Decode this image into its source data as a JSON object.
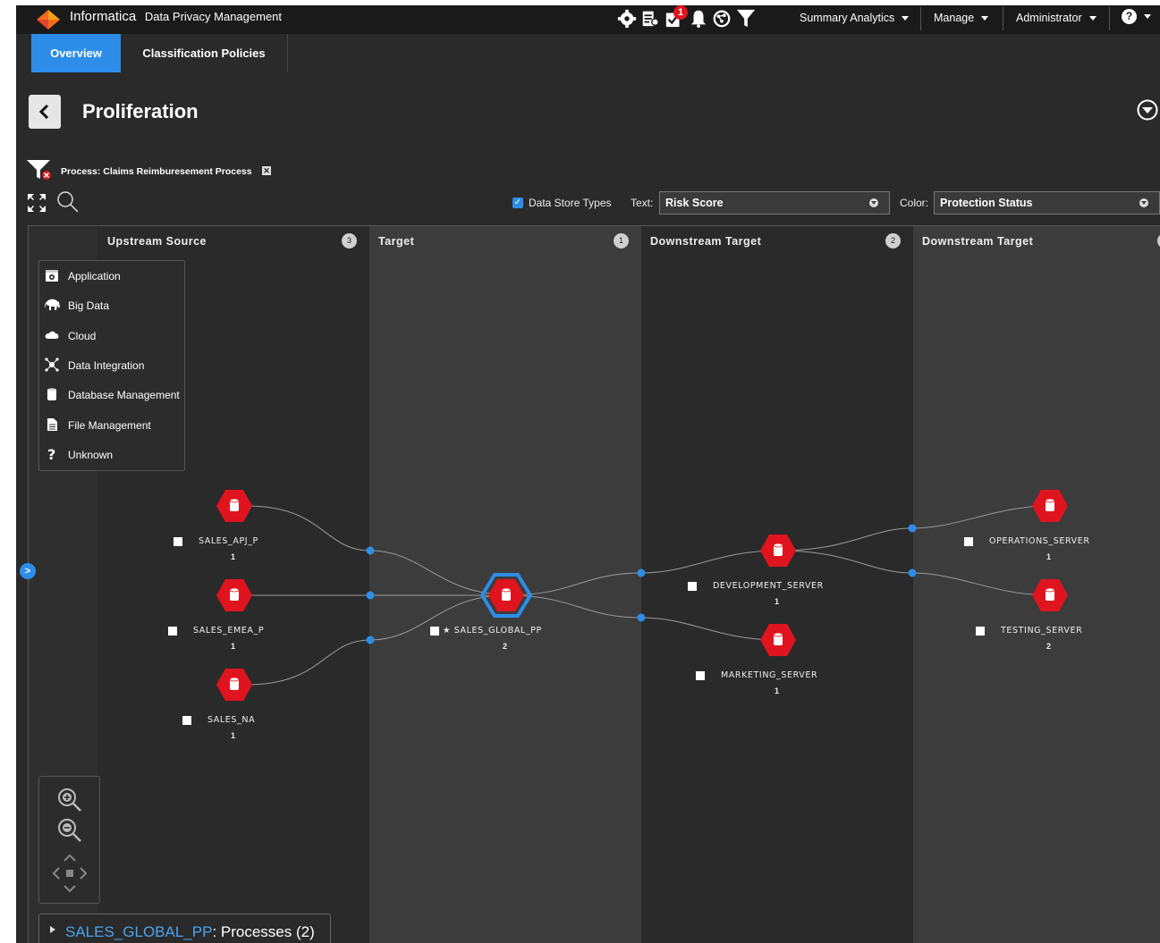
{
  "app": {
    "brand": "Informatica",
    "product": "Data Privacy Management"
  },
  "topbar": {
    "icons": [
      "gear-icon",
      "report-icon",
      "tasks-icon",
      "bell-icon",
      "network-icon",
      "filter-icon"
    ],
    "badge_count": "1",
    "menus": [
      {
        "label": "Summary Analytics"
      },
      {
        "label": "Manage"
      },
      {
        "label": "Administrator"
      }
    ],
    "help_icon": "help-icon"
  },
  "tabs": [
    {
      "label": "Overview",
      "active": true
    },
    {
      "label": "Classification Policies",
      "active": false
    }
  ],
  "header": {
    "title": "Proliferation",
    "back_icon": "chevron-left-icon"
  },
  "filter": {
    "text": "Process: Claims Reimburesement Process",
    "close": "✕"
  },
  "toolbar": {
    "data_store_types_label": "Data Store Types",
    "data_store_types_checked": true,
    "text_label": "Text:",
    "text_value": "Risk Score",
    "color_label": "Color:",
    "color_value": "Protection Status"
  },
  "columns": [
    {
      "title": "Upstream Source",
      "count": "3"
    },
    {
      "title": "Target",
      "count": "1"
    },
    {
      "title": "Downstream Target",
      "count": "2"
    },
    {
      "title": "Downstream Target",
      "count": ""
    }
  ],
  "legend": [
    {
      "label": "Application",
      "icon": "application-icon"
    },
    {
      "label": "Big Data",
      "icon": "elephant-icon"
    },
    {
      "label": "Cloud",
      "icon": "cloud-icon"
    },
    {
      "label": "Data Integration",
      "icon": "integration-icon"
    },
    {
      "label": "Database Management",
      "icon": "database-icon"
    },
    {
      "label": "File Management",
      "icon": "file-icon"
    },
    {
      "label": "Unknown",
      "icon": "question-icon"
    }
  ],
  "nodes": [
    {
      "label": "SALES_APJ_P",
      "score": "1"
    },
    {
      "label": "SALES_EMEA_P",
      "score": "1"
    },
    {
      "label": "SALES_NA",
      "score": "1"
    },
    {
      "label": "★ SALES_GLOBAL_PP",
      "score": "2"
    },
    {
      "label": "DEVELOPMENT_SERVER",
      "score": "1"
    },
    {
      "label": "MARKETING_SERVER",
      "score": "1"
    },
    {
      "label": "OPERATIONS_SERVER",
      "score": "1"
    },
    {
      "label": "TESTING_SERVER",
      "score": "2"
    }
  ],
  "colors": {
    "accent": "#2d8de8",
    "node": "#e0141e",
    "selected_ring": "#2d8de8"
  },
  "process_bar": {
    "name": "SALES_GLOBAL_PP",
    "rest": ": Processes (2)"
  },
  "side_toggle": ">"
}
